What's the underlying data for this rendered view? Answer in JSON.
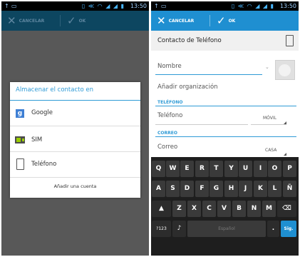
{
  "status": {
    "left_icon_1": "↑",
    "left_icon_2": "▭",
    "right_icons": "▯ ≪ ◠ ◢ ◢ ▮",
    "time": "13:50"
  },
  "left": {
    "action_bar": {
      "cancel_label": "CANCELAR",
      "ok_label": "OK"
    },
    "dialog": {
      "title": "Almacenar el contacto en",
      "items": [
        {
          "label": "Google",
          "icon": "google-icon"
        },
        {
          "label": "SIM",
          "icon": "sim-card-icon"
        },
        {
          "label": "Teléfono",
          "icon": "phone-icon"
        }
      ],
      "footer": "Añadir una cuenta"
    }
  },
  "right": {
    "action_bar": {
      "cancel_label": "CANCELAR",
      "ok_label": "OK"
    },
    "account": {
      "label": "Contacto de Teléfono"
    },
    "name_field": {
      "placeholder": "Nombre"
    },
    "organization_link": "Añadir organización",
    "phone_section": {
      "title": "TELÉFONO",
      "placeholder": "Teléfono",
      "type": "MÓVIL"
    },
    "email_section": {
      "title": "CORREO",
      "placeholder": "Correo",
      "type": "CASA"
    },
    "keyboard": {
      "row1": [
        "Q",
        "W",
        "E",
        "R",
        "T",
        "Y",
        "U",
        "I",
        "O",
        "P"
      ],
      "row2": [
        "A",
        "S",
        "D",
        "F",
        "G",
        "H",
        "J",
        "K",
        "L",
        "Ñ"
      ],
      "row3": [
        "Z",
        "X",
        "C",
        "V",
        "B",
        "N",
        "M"
      ],
      "shift_icon": "shift-icon",
      "delete_icon": "backspace-icon",
      "symbols_label": "?123",
      "mic_icon": "microphone-icon",
      "space_label": "Español",
      "period_label": ".",
      "next_label": "Sig."
    }
  }
}
